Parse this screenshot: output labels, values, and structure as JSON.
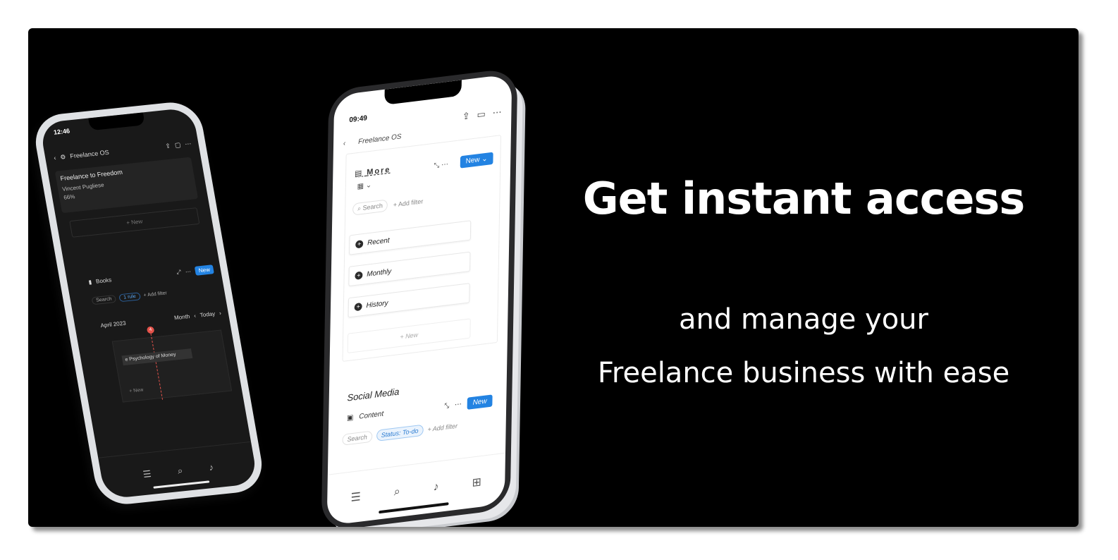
{
  "headline": "Get instant access",
  "subline1": "and manage your",
  "subline2": "Freelance business with ease",
  "back_phone": {
    "time": "12:46",
    "title": "Freelance OS",
    "card": {
      "title": "Freelance to Freedom",
      "author": "Vincent Pugliese",
      "progress": "66%"
    },
    "new_label": "+ New",
    "db_name": "Books",
    "new_button": "New",
    "search": "Search",
    "rule": "1 rule",
    "add_filter": "+ Add filter",
    "month": "April 2023",
    "month_switch": "Month",
    "today": "Today",
    "today_date": "4",
    "event": "e Psychology of Money",
    "new_label2": "+ New"
  },
  "front_phone": {
    "time": "09:49",
    "title": "Freelance OS",
    "section": "More",
    "new_button": "New",
    "search": "Search",
    "add_filter": "+ Add filter",
    "rows": [
      "Recent",
      "Monthly",
      "History"
    ],
    "new_label": "+ New",
    "section2": "Social Media",
    "db2": "Content",
    "status_filter": "Status: To-do"
  },
  "colors": {
    "background": "#000000",
    "accent": "#2383e2",
    "today": "#e5534b"
  }
}
